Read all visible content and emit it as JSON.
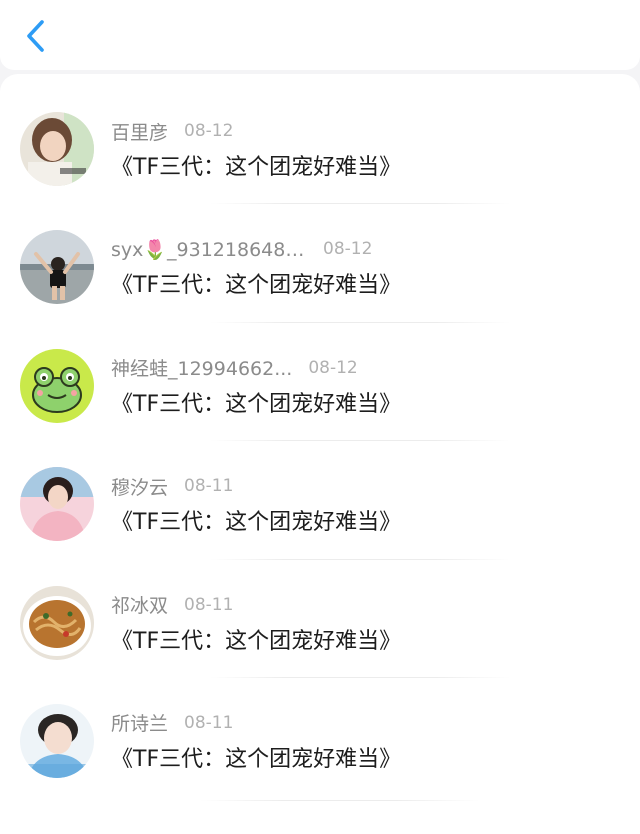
{
  "header": {
    "back_icon": "chevron-left-icon",
    "accent_color": "#2d9cf5"
  },
  "comments": [
    {
      "name": "百里彦",
      "date": "08-12",
      "title": "《TF三代：这个团宠好难当》",
      "avatar_icon": "girl-photo-avatar"
    },
    {
      "name": "syx🌷_9312186481...",
      "date": "08-12",
      "title": "《TF三代：这个团宠好难当》",
      "avatar_icon": "beach-person-avatar"
    },
    {
      "name": "神经蛙_12994662...",
      "date": "08-12",
      "title": "《TF三代：这个团宠好难当》",
      "avatar_icon": "frog-avatar"
    },
    {
      "name": "穆汐云",
      "date": "08-11",
      "title": "《TF三代：这个团宠好难当》",
      "avatar_icon": "pink-portrait-avatar"
    },
    {
      "name": "祁冰双",
      "date": "08-11",
      "title": "《TF三代：这个团宠好难当》",
      "avatar_icon": "noodle-bowl-avatar"
    },
    {
      "name": "所诗兰",
      "date": "08-11",
      "title": "《TF三代：这个团宠好难当》",
      "avatar_icon": "boy-portrait-avatar"
    }
  ]
}
